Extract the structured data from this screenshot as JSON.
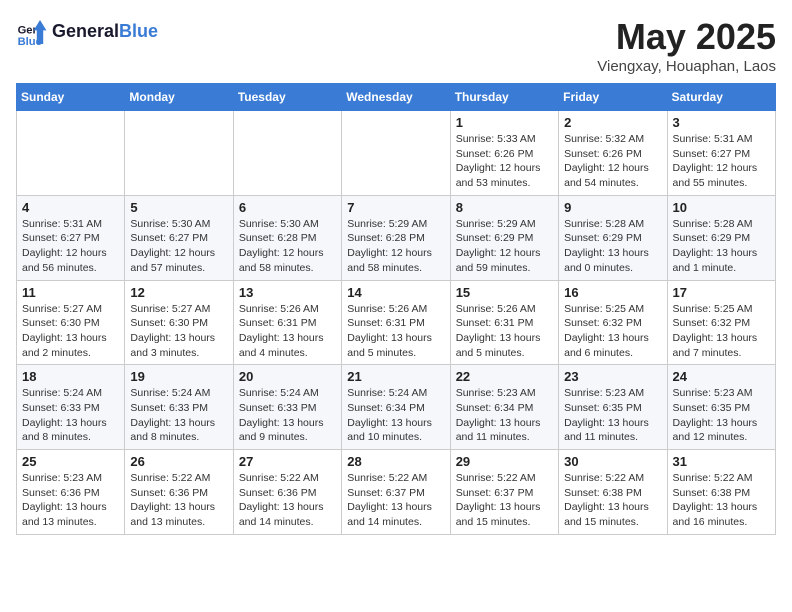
{
  "header": {
    "logo_line1": "General",
    "logo_line2": "Blue",
    "month_title": "May 2025",
    "subtitle": "Viengxay, Houaphan, Laos"
  },
  "weekdays": [
    "Sunday",
    "Monday",
    "Tuesday",
    "Wednesday",
    "Thursday",
    "Friday",
    "Saturday"
  ],
  "weeks": [
    [
      {
        "day": "",
        "info": ""
      },
      {
        "day": "",
        "info": ""
      },
      {
        "day": "",
        "info": ""
      },
      {
        "day": "",
        "info": ""
      },
      {
        "day": "1",
        "info": "Sunrise: 5:33 AM\nSunset: 6:26 PM\nDaylight: 12 hours\nand 53 minutes."
      },
      {
        "day": "2",
        "info": "Sunrise: 5:32 AM\nSunset: 6:26 PM\nDaylight: 12 hours\nand 54 minutes."
      },
      {
        "day": "3",
        "info": "Sunrise: 5:31 AM\nSunset: 6:27 PM\nDaylight: 12 hours\nand 55 minutes."
      }
    ],
    [
      {
        "day": "4",
        "info": "Sunrise: 5:31 AM\nSunset: 6:27 PM\nDaylight: 12 hours\nand 56 minutes."
      },
      {
        "day": "5",
        "info": "Sunrise: 5:30 AM\nSunset: 6:27 PM\nDaylight: 12 hours\nand 57 minutes."
      },
      {
        "day": "6",
        "info": "Sunrise: 5:30 AM\nSunset: 6:28 PM\nDaylight: 12 hours\nand 58 minutes."
      },
      {
        "day": "7",
        "info": "Sunrise: 5:29 AM\nSunset: 6:28 PM\nDaylight: 12 hours\nand 58 minutes."
      },
      {
        "day": "8",
        "info": "Sunrise: 5:29 AM\nSunset: 6:29 PM\nDaylight: 12 hours\nand 59 minutes."
      },
      {
        "day": "9",
        "info": "Sunrise: 5:28 AM\nSunset: 6:29 PM\nDaylight: 13 hours\nand 0 minutes."
      },
      {
        "day": "10",
        "info": "Sunrise: 5:28 AM\nSunset: 6:29 PM\nDaylight: 13 hours\nand 1 minute."
      }
    ],
    [
      {
        "day": "11",
        "info": "Sunrise: 5:27 AM\nSunset: 6:30 PM\nDaylight: 13 hours\nand 2 minutes."
      },
      {
        "day": "12",
        "info": "Sunrise: 5:27 AM\nSunset: 6:30 PM\nDaylight: 13 hours\nand 3 minutes."
      },
      {
        "day": "13",
        "info": "Sunrise: 5:26 AM\nSunset: 6:31 PM\nDaylight: 13 hours\nand 4 minutes."
      },
      {
        "day": "14",
        "info": "Sunrise: 5:26 AM\nSunset: 6:31 PM\nDaylight: 13 hours\nand 5 minutes."
      },
      {
        "day": "15",
        "info": "Sunrise: 5:26 AM\nSunset: 6:31 PM\nDaylight: 13 hours\nand 5 minutes."
      },
      {
        "day": "16",
        "info": "Sunrise: 5:25 AM\nSunset: 6:32 PM\nDaylight: 13 hours\nand 6 minutes."
      },
      {
        "day": "17",
        "info": "Sunrise: 5:25 AM\nSunset: 6:32 PM\nDaylight: 13 hours\nand 7 minutes."
      }
    ],
    [
      {
        "day": "18",
        "info": "Sunrise: 5:24 AM\nSunset: 6:33 PM\nDaylight: 13 hours\nand 8 minutes."
      },
      {
        "day": "19",
        "info": "Sunrise: 5:24 AM\nSunset: 6:33 PM\nDaylight: 13 hours\nand 8 minutes."
      },
      {
        "day": "20",
        "info": "Sunrise: 5:24 AM\nSunset: 6:33 PM\nDaylight: 13 hours\nand 9 minutes."
      },
      {
        "day": "21",
        "info": "Sunrise: 5:24 AM\nSunset: 6:34 PM\nDaylight: 13 hours\nand 10 minutes."
      },
      {
        "day": "22",
        "info": "Sunrise: 5:23 AM\nSunset: 6:34 PM\nDaylight: 13 hours\nand 11 minutes."
      },
      {
        "day": "23",
        "info": "Sunrise: 5:23 AM\nSunset: 6:35 PM\nDaylight: 13 hours\nand 11 minutes."
      },
      {
        "day": "24",
        "info": "Sunrise: 5:23 AM\nSunset: 6:35 PM\nDaylight: 13 hours\nand 12 minutes."
      }
    ],
    [
      {
        "day": "25",
        "info": "Sunrise: 5:23 AM\nSunset: 6:36 PM\nDaylight: 13 hours\nand 13 minutes."
      },
      {
        "day": "26",
        "info": "Sunrise: 5:22 AM\nSunset: 6:36 PM\nDaylight: 13 hours\nand 13 minutes."
      },
      {
        "day": "27",
        "info": "Sunrise: 5:22 AM\nSunset: 6:36 PM\nDaylight: 13 hours\nand 14 minutes."
      },
      {
        "day": "28",
        "info": "Sunrise: 5:22 AM\nSunset: 6:37 PM\nDaylight: 13 hours\nand 14 minutes."
      },
      {
        "day": "29",
        "info": "Sunrise: 5:22 AM\nSunset: 6:37 PM\nDaylight: 13 hours\nand 15 minutes."
      },
      {
        "day": "30",
        "info": "Sunrise: 5:22 AM\nSunset: 6:38 PM\nDaylight: 13 hours\nand 15 minutes."
      },
      {
        "day": "31",
        "info": "Sunrise: 5:22 AM\nSunset: 6:38 PM\nDaylight: 13 hours\nand 16 minutes."
      }
    ]
  ]
}
